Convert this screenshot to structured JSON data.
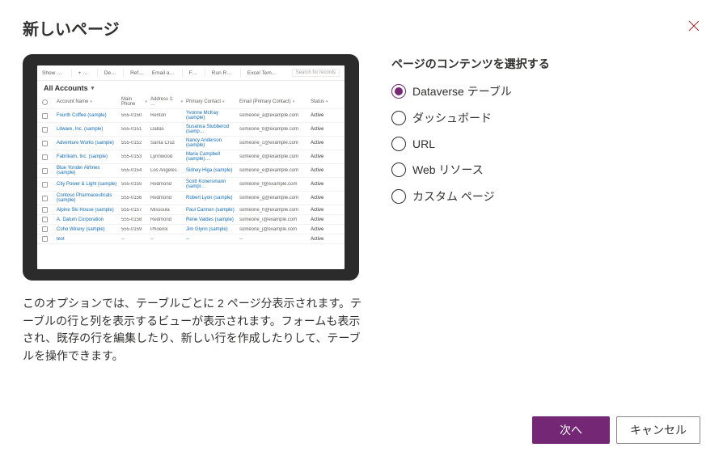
{
  "dialog": {
    "title": "新しいページ"
  },
  "preview": {
    "toolbar": {
      "show_chart": "Show Chart",
      "new": "New",
      "delete": "Delete",
      "refresh": "Refresh",
      "email_link": "Email a Link",
      "flow": "Flow",
      "run_report": "Run Report",
      "excel_templates": "Excel Templates",
      "search_placeholder": "Search for records"
    },
    "view_title": "All Accounts",
    "columns": {
      "name": "Account Name",
      "phone": "Main Phone",
      "address": "Address 1: …",
      "contact": "Primary Contact",
      "email": "Email (Primary Contact)",
      "status": "Status"
    },
    "rows": [
      {
        "name": "Fourth Coffee (sample)",
        "phone": "555-0150",
        "city": "Renton",
        "contact": "Yvonne McKay (sample)",
        "email": "someone_a@example.com",
        "status": "Active"
      },
      {
        "name": "Litware, Inc. (sample)",
        "phone": "555-0151",
        "city": "Dallas",
        "contact": "Susanna Stubberod (samp…",
        "email": "someone_b@example.com",
        "status": "Active"
      },
      {
        "name": "Adventure Works (sample)",
        "phone": "555-0152",
        "city": "Santa Cruz",
        "contact": "Nancy Anderson (sample)",
        "email": "someone_c@example.com",
        "status": "Active"
      },
      {
        "name": "Fabrikam, Inc. (sample)",
        "phone": "555-0153",
        "city": "Lynnwood",
        "contact": "Maria Campbell (sample)…",
        "email": "someone_d@example.com",
        "status": "Active"
      },
      {
        "name": "Blue Yonder Airlines (sample)",
        "phone": "555-0154",
        "city": "Los Angeles",
        "contact": "Sidney Higa (sample)",
        "email": "someone_e@example.com",
        "status": "Active"
      },
      {
        "name": "City Power & Light (sample)",
        "phone": "555-0155",
        "city": "Redmond",
        "contact": "Scott Konersmann (sampl…",
        "email": "someone_f@example.com",
        "status": "Active"
      },
      {
        "name": "Contoso Pharmaceuticals (sample)",
        "phone": "555-0156",
        "city": "Redmond",
        "contact": "Robert Lyon (sample)",
        "email": "someone_g@example.com",
        "status": "Active"
      },
      {
        "name": "Alpine Ski House (sample)",
        "phone": "555-0157",
        "city": "Missoula",
        "contact": "Paul Cannon (sample)",
        "email": "someone_h@example.com",
        "status": "Active"
      },
      {
        "name": "A. Datum Corporation",
        "phone": "555-0158",
        "city": "Redmond",
        "contact": "Rene Valdes (sample)",
        "email": "someone_i@example.com",
        "status": "Active"
      },
      {
        "name": "Coho Winery (sample)",
        "phone": "555-0159",
        "city": "Phoenix",
        "contact": "Jim Glynn (sample)",
        "email": "someone_j@example.com",
        "status": "Active"
      },
      {
        "name": "test",
        "phone": "--",
        "city": "--",
        "contact": "--",
        "email": "--",
        "status": "Active"
      }
    ]
  },
  "description": "このオプションでは、テーブルごとに 2 ページ分表示されます。テーブルの行と列を表示するビューが表示されます。フォームも表示され、既存の行を編集したり、新しい行を作成したりして、テーブルを操作できます。",
  "section_title": "ページのコンテンツを選択する",
  "options": [
    {
      "key": "dataverse",
      "label": "Dataverse テーブル",
      "selected": true
    },
    {
      "key": "dashboard",
      "label": "ダッシュボード",
      "selected": false
    },
    {
      "key": "url",
      "label": "URL",
      "selected": false
    },
    {
      "key": "webresource",
      "label": "Web リソース",
      "selected": false
    },
    {
      "key": "custom",
      "label": "カスタム ページ",
      "selected": false
    }
  ],
  "buttons": {
    "next": "次へ",
    "cancel": "キャンセル"
  }
}
